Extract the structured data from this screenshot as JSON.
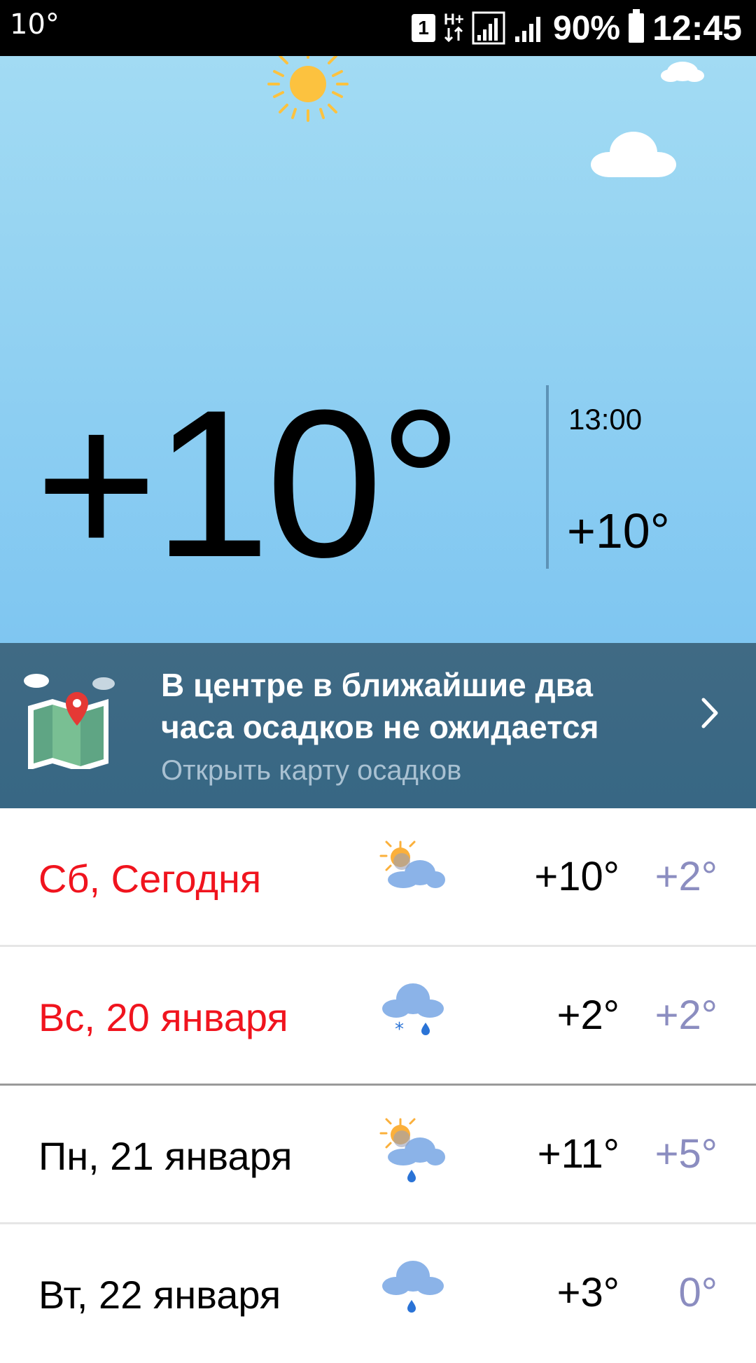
{
  "status_bar": {
    "notification_temp": "10°",
    "sim_label": "1",
    "network_type": "H+",
    "battery_percent": "90%",
    "time": "12:45"
  },
  "current": {
    "temperature": "+10°",
    "hourly": [
      {
        "time": "13:00",
        "temp": "+10°"
      }
    ]
  },
  "precip_banner": {
    "title": "В центре в ближайшие два часа осадков не ожидается",
    "link": "Открыть карту осадков"
  },
  "forecast": [
    {
      "label": "Сб, Сегодня",
      "high": "+10°",
      "low": "+2°",
      "icon": "partly-cloudy-icon",
      "weekend": true
    },
    {
      "label": "Вс, 20 января",
      "high": "+2°",
      "low": "+2°",
      "icon": "snow-rain-icon",
      "weekend": true
    },
    {
      "label": "Пн, 21 января",
      "high": "+11°",
      "low": "+5°",
      "icon": "partly-cloudy-rain-icon",
      "weekend": false
    },
    {
      "label": "Вт, 22 января",
      "high": "+3°",
      "low": "0°",
      "icon": "cloud-rain-icon",
      "weekend": false
    }
  ],
  "colors": {
    "sky_top": "#a2dbf3",
    "sky_bottom": "#7fc6f1",
    "banner": "#3f6984",
    "weekend_red": "#f0141e",
    "low_temp": "#8b8dc0"
  }
}
